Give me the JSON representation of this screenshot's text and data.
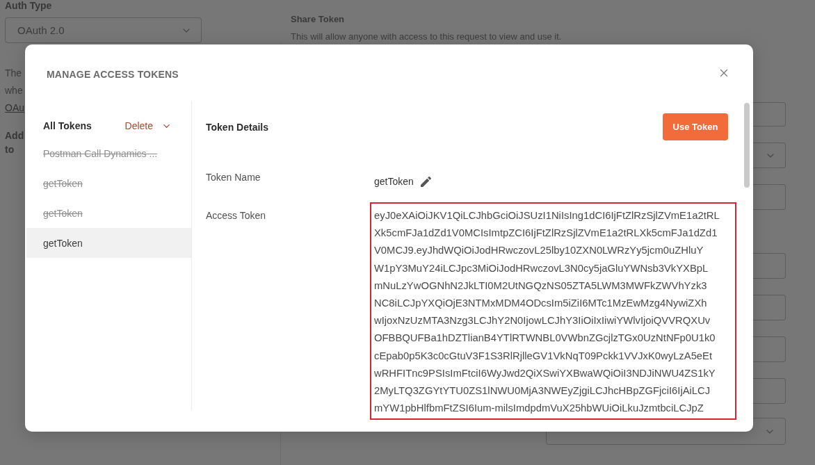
{
  "background": {
    "auth_type": {
      "label": "Auth Type",
      "value": "OAuth 2.0"
    },
    "description": {
      "lines": [
        "The",
        "whe"
      ],
      "link": "OAu"
    },
    "section_label": {
      "lines": [
        "Add",
        "to"
      ]
    },
    "share_token": {
      "title": "Share Token",
      "description": "This will allow anyone with access to this request to view and use it."
    },
    "side_fields": {
      "upper": [
        {
          "kind": "input"
        },
        {
          "kind": "select"
        },
        {
          "kind": "input"
        }
      ],
      "lower": [
        {
          "kind": "input"
        },
        {
          "kind": "input"
        },
        {
          "kind": "input"
        },
        {
          "kind": "input"
        }
      ],
      "footer": {
        "kind": "select"
      }
    }
  },
  "modal": {
    "title": "MANAGE ACCESS TOKENS",
    "sidebar": {
      "heading": "All Tokens",
      "action": "Delete",
      "tokens": [
        {
          "name": "Postman Call Dynamics ...",
          "expired": true,
          "selected": false
        },
        {
          "name": "getToken",
          "expired": true,
          "selected": false
        },
        {
          "name": "getToken",
          "expired": true,
          "selected": false
        },
        {
          "name": "getToken",
          "expired": false,
          "selected": true
        }
      ]
    },
    "details": {
      "title": "Token Details",
      "use_button": "Use Token",
      "fields": [
        {
          "kind": "name",
          "label": "Token Name",
          "value": "getToken"
        },
        {
          "kind": "token",
          "label": "Access Token",
          "lines": [
            "eyJ0eXAiOiJKV1QiLCJhbGciOiJSUzI1NiIsIng1dCI6IjFtZlRzSjlZVmE1a2tRL",
            "Xk5cmFJa1dZd1V0MCIsImtpZCI6IjFtZlRzSjlZVmE1a2tRLXk5cmFJa1dZd1",
            "V0MCJ9.eyJhdWQiOiJodHRwczovL25lby10ZXN0LWRzYy5jcm0uZHluY",
            "W1pY3MuY24iLCJpc3MiOiJodHRwczovL3N0cy5jaGluYWNsb3VkYXBpL",
            "mNuLzYwOGNhN2JkLTI0M2UtNGQzNS05ZTA5LWM3MWFkZWVhYzk3",
            "NC8iLCJpYXQiOjE3NTMxMDM4ODcsIm5iZiI6MTc1MzEwMzg4NywiZXh",
            "wIjoxNzUzMTA3Nzg3LCJhY2N0IjowLCJhY3IiOiIxIiwiYWlvIjoiQVVRQXUv",
            "OFBBQUFBa1hDZTlianB4YTlRTWNBL0VWbnZGcjlzTGx0UzNtNFp0U1k0",
            "cEpab0p5K3c0cGtuV3F1S3RlRjlleGV1VkNqT09Pckk1VVJxK0wyLzA5eEt",
            "wRHFITnc9PSIsImFtciI6WyJwd2QiXSwiYXBwaWQiOiI3NDJiNWU4ZS1kY",
            "2MyLTQ3ZGYtYTU0ZS1lNWU0MjA3NWEyZjgiLCJhcHBpZGFjciI6IjAiLCJ",
            "mYW1pbHlfbmFtZSI6Ium-milsImdpdmVuX25hbWUiOiLkuJzmtbciLCJpZ"
          ]
        }
      ]
    }
  }
}
